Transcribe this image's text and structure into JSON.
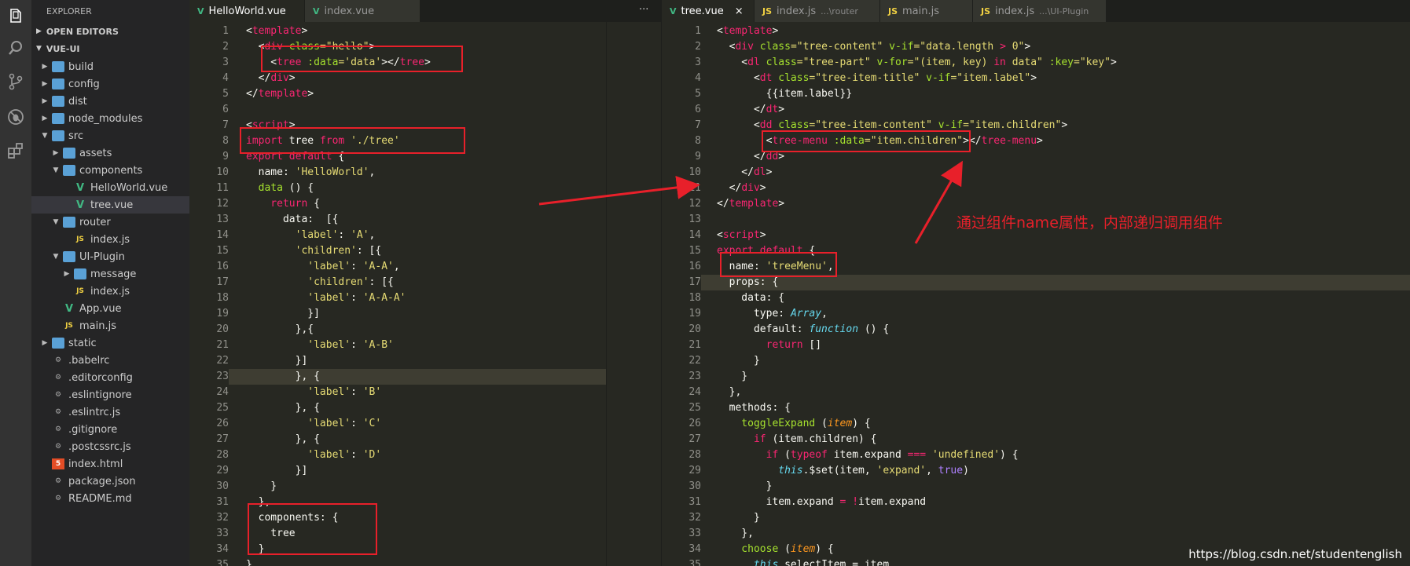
{
  "explorer": {
    "title": "EXPLORER",
    "open_editors": "OPEN EDITORS",
    "project": "VUE-UI",
    "tree": [
      {
        "label": "build",
        "type": "folder",
        "depth": 1,
        "expanded": false
      },
      {
        "label": "config",
        "type": "folder",
        "depth": 1,
        "expanded": false
      },
      {
        "label": "dist",
        "type": "folder",
        "depth": 1,
        "expanded": false
      },
      {
        "label": "node_modules",
        "type": "folder",
        "depth": 1,
        "expanded": false
      },
      {
        "label": "src",
        "type": "folder",
        "depth": 1,
        "expanded": true
      },
      {
        "label": "assets",
        "type": "folder",
        "depth": 2,
        "expanded": false
      },
      {
        "label": "components",
        "type": "folder",
        "depth": 2,
        "expanded": true
      },
      {
        "label": "HelloWorld.vue",
        "type": "vue",
        "depth": 3
      },
      {
        "label": "tree.vue",
        "type": "vue",
        "depth": 3,
        "selected": true
      },
      {
        "label": "router",
        "type": "folder",
        "depth": 2,
        "expanded": true
      },
      {
        "label": "index.js",
        "type": "js",
        "depth": 3
      },
      {
        "label": "UI-Plugin",
        "type": "folder",
        "depth": 2,
        "expanded": true
      },
      {
        "label": "message",
        "type": "folder",
        "depth": 3,
        "expanded": false
      },
      {
        "label": "index.js",
        "type": "js",
        "depth": 3
      },
      {
        "label": "App.vue",
        "type": "vue",
        "depth": 2
      },
      {
        "label": "main.js",
        "type": "js",
        "depth": 2
      },
      {
        "label": "static",
        "type": "folder",
        "depth": 1,
        "expanded": false
      },
      {
        "label": ".babelrc",
        "type": "cfg",
        "depth": 1
      },
      {
        "label": ".editorconfig",
        "type": "cfg",
        "depth": 1
      },
      {
        "label": ".eslintignore",
        "type": "cfg",
        "depth": 1
      },
      {
        "label": ".eslintrc.js",
        "type": "cfg",
        "depth": 1
      },
      {
        "label": ".gitignore",
        "type": "cfg",
        "depth": 1
      },
      {
        "label": ".postcssrc.js",
        "type": "cfg",
        "depth": 1
      },
      {
        "label": "index.html",
        "type": "html",
        "depth": 1
      },
      {
        "label": "package.json",
        "type": "cfg",
        "depth": 1
      },
      {
        "label": "README.md",
        "type": "cfg",
        "depth": 1
      }
    ]
  },
  "left_tabs": [
    {
      "label": "HelloWorld.vue",
      "icon": "vue",
      "active": true
    },
    {
      "label": "index.vue",
      "icon": "vue",
      "active": false
    }
  ],
  "left_tab_more": "···",
  "right_tabs": [
    {
      "label": "tree.vue",
      "icon": "vue",
      "active": true,
      "close": "×"
    },
    {
      "label": "index.js",
      "icon": "JS",
      "desc": "...\\router"
    },
    {
      "label": "main.js",
      "icon": "JS"
    },
    {
      "label": "index.js",
      "icon": "JS",
      "desc": "...\\UI-Plugin"
    }
  ],
  "left_code": [
    [
      [
        "<",
        "p"
      ],
      [
        "template",
        "k"
      ],
      [
        ">",
        "p"
      ]
    ],
    [
      [
        "  <",
        "p"
      ],
      [
        "div ",
        "k"
      ],
      [
        "class",
        "a"
      ],
      [
        "=\"hello\"",
        "s"
      ],
      [
        ">",
        "p"
      ]
    ],
    [
      [
        "    <",
        "p"
      ],
      [
        "tree ",
        "k"
      ],
      [
        ":data",
        "a"
      ],
      [
        "='data'",
        "s"
      ],
      [
        "></",
        "p"
      ],
      [
        "tree",
        "k"
      ],
      [
        ">",
        "p"
      ]
    ],
    [
      [
        "  </",
        "p"
      ],
      [
        "div",
        "k"
      ],
      [
        ">",
        "p"
      ]
    ],
    [
      [
        "</",
        "p"
      ],
      [
        "template",
        "k"
      ],
      [
        ">",
        "p"
      ]
    ],
    [],
    [
      [
        "<",
        "p"
      ],
      [
        "script",
        "k"
      ],
      [
        ">",
        "p"
      ]
    ],
    [
      [
        "import ",
        "k"
      ],
      [
        "tree ",
        "p"
      ],
      [
        "from ",
        "k"
      ],
      [
        "'./tree'",
        "s"
      ]
    ],
    [
      [
        "export default ",
        "k"
      ],
      [
        "{",
        "p"
      ]
    ],
    [
      [
        "  name",
        "p"
      ],
      [
        ": ",
        "p"
      ],
      [
        "'HelloWorld'",
        "s"
      ],
      [
        ",",
        "p"
      ]
    ],
    [
      [
        "  data ",
        "a"
      ],
      [
        "() {",
        "p"
      ]
    ],
    [
      [
        "    return ",
        "k"
      ],
      [
        "{",
        "p"
      ]
    ],
    [
      [
        "      data:  [{",
        "p"
      ]
    ],
    [
      [
        "        'label'",
        "s"
      ],
      [
        ": ",
        "p"
      ],
      [
        "'A'",
        "s"
      ],
      [
        ",",
        "p"
      ]
    ],
    [
      [
        "        'children'",
        "s"
      ],
      [
        ": [{",
        "p"
      ]
    ],
    [
      [
        "          'label'",
        "s"
      ],
      [
        ": ",
        "p"
      ],
      [
        "'A-A'",
        "s"
      ],
      [
        ",",
        "p"
      ]
    ],
    [
      [
        "          'children'",
        "s"
      ],
      [
        ": [{",
        "p"
      ]
    ],
    [
      [
        "          'label'",
        "s"
      ],
      [
        ": ",
        "p"
      ],
      [
        "'A-A-A'",
        "s"
      ]
    ],
    [
      [
        "          }]",
        "p"
      ]
    ],
    [
      [
        "        },{",
        "p"
      ]
    ],
    [
      [
        "          'label'",
        "s"
      ],
      [
        ": ",
        "p"
      ],
      [
        "'A-B'",
        "s"
      ]
    ],
    [
      [
        "        }]",
        "p"
      ]
    ],
    [
      [
        "        }, {",
        "p"
      ]
    ],
    [
      [
        "          'label'",
        "s"
      ],
      [
        ": ",
        "p"
      ],
      [
        "'B'",
        "s"
      ]
    ],
    [
      [
        "        }, {",
        "p"
      ]
    ],
    [
      [
        "          'label'",
        "s"
      ],
      [
        ": ",
        "p"
      ],
      [
        "'C'",
        "s"
      ]
    ],
    [
      [
        "        }, {",
        "p"
      ]
    ],
    [
      [
        "          'label'",
        "s"
      ],
      [
        ": ",
        "p"
      ],
      [
        "'D'",
        "s"
      ]
    ],
    [
      [
        "        }]",
        "p"
      ]
    ],
    [
      [
        "    }",
        "p"
      ]
    ],
    [
      [
        "  },",
        "p"
      ]
    ],
    [
      [
        "  components: {",
        "p"
      ]
    ],
    [
      [
        "    tree",
        "p"
      ]
    ],
    [
      [
        "  }",
        "p"
      ]
    ],
    [
      [
        "}",
        "p"
      ]
    ]
  ],
  "right_code": [
    [
      [
        "<",
        "p"
      ],
      [
        "template",
        "k"
      ],
      [
        ">",
        "p"
      ]
    ],
    [
      [
        "  <",
        "p"
      ],
      [
        "div ",
        "k"
      ],
      [
        "class",
        "a"
      ],
      [
        "=\"tree-content\" ",
        "s"
      ],
      [
        "v-if",
        "a"
      ],
      [
        "=\"data.length ",
        "s"
      ],
      [
        ">",
        "k"
      ],
      [
        " 0\"",
        "s"
      ],
      [
        ">",
        "p"
      ]
    ],
    [
      [
        "    <",
        "p"
      ],
      [
        "dl ",
        "k"
      ],
      [
        "class",
        "a"
      ],
      [
        "=\"tree-part\" ",
        "s"
      ],
      [
        "v-for",
        "a"
      ],
      [
        "=\"(item, key) ",
        "s"
      ],
      [
        "in",
        "k"
      ],
      [
        " data\" ",
        "s"
      ],
      [
        ":key",
        "a"
      ],
      [
        "=\"key\"",
        "s"
      ],
      [
        ">",
        "p"
      ]
    ],
    [
      [
        "      <",
        "p"
      ],
      [
        "dt ",
        "k"
      ],
      [
        "class",
        "a"
      ],
      [
        "=\"tree-item-title\" ",
        "s"
      ],
      [
        "v-if",
        "a"
      ],
      [
        "=\"item.label\"",
        "s"
      ],
      [
        ">",
        "p"
      ]
    ],
    [
      [
        "        {{item.label}}",
        "p"
      ]
    ],
    [
      [
        "      </",
        "p"
      ],
      [
        "dt",
        "k"
      ],
      [
        ">",
        "p"
      ]
    ],
    [
      [
        "      <",
        "p"
      ],
      [
        "dd ",
        "k"
      ],
      [
        "class",
        "a"
      ],
      [
        "=\"tree-item-content\" ",
        "s"
      ],
      [
        "v-if",
        "a"
      ],
      [
        "=\"item.children\"",
        "s"
      ],
      [
        ">",
        "p"
      ]
    ],
    [
      [
        "        <",
        "p"
      ],
      [
        "tree-menu ",
        "k"
      ],
      [
        ":data",
        "a"
      ],
      [
        "=\"item.children\"",
        "s"
      ],
      [
        "></",
        "p"
      ],
      [
        "tree-menu",
        "k"
      ],
      [
        ">",
        "p"
      ]
    ],
    [
      [
        "      </",
        "p"
      ],
      [
        "dd",
        "k"
      ],
      [
        ">",
        "p"
      ]
    ],
    [
      [
        "    </",
        "p"
      ],
      [
        "dl",
        "k"
      ],
      [
        ">",
        "p"
      ]
    ],
    [
      [
        "  </",
        "p"
      ],
      [
        "div",
        "k"
      ],
      [
        ">",
        "p"
      ]
    ],
    [
      [
        "</",
        "p"
      ],
      [
        "template",
        "k"
      ],
      [
        ">",
        "p"
      ]
    ],
    [],
    [
      [
        "<",
        "p"
      ],
      [
        "script",
        "k"
      ],
      [
        ">",
        "p"
      ]
    ],
    [
      [
        "export default ",
        "k"
      ],
      [
        "{",
        "p"
      ]
    ],
    [
      [
        "  name",
        "p"
      ],
      [
        ": ",
        "p"
      ],
      [
        "'treeMenu'",
        "s"
      ],
      [
        ",",
        "p"
      ]
    ],
    [
      [
        "  props",
        "p"
      ],
      [
        ": {",
        "p"
      ]
    ],
    [
      [
        "    data",
        "p"
      ],
      [
        ": {",
        "p"
      ]
    ],
    [
      [
        "      type",
        "p"
      ],
      [
        ": ",
        "p"
      ],
      [
        "Array",
        "t"
      ],
      [
        ",",
        "p"
      ]
    ],
    [
      [
        "      default",
        "p"
      ],
      [
        ": ",
        "p"
      ],
      [
        "function ",
        "t"
      ],
      [
        "() {",
        "p"
      ]
    ],
    [
      [
        "        return ",
        "k"
      ],
      [
        "[]",
        "p"
      ]
    ],
    [
      [
        "      }",
        "p"
      ]
    ],
    [
      [
        "    }",
        "p"
      ]
    ],
    [
      [
        "  },",
        "p"
      ]
    ],
    [
      [
        "  methods: {",
        "p"
      ]
    ],
    [
      [
        "    toggleExpand ",
        "a"
      ],
      [
        "(",
        "p"
      ],
      [
        "item",
        "pi"
      ],
      [
        ") {",
        "p"
      ]
    ],
    [
      [
        "      if ",
        "k"
      ],
      [
        "(item.children) {",
        "p"
      ]
    ],
    [
      [
        "        if ",
        "k"
      ],
      [
        "(",
        "p"
      ],
      [
        "typeof ",
        "k"
      ],
      [
        "item.expand ",
        "p"
      ],
      [
        "=== ",
        "k"
      ],
      [
        "'undefined'",
        "s"
      ],
      [
        ") {",
        "p"
      ]
    ],
    [
      [
        "          this",
        "t"
      ],
      [
        ".$set(item, ",
        "p"
      ],
      [
        "'expand'",
        "s"
      ],
      [
        ", ",
        "p"
      ],
      [
        "true",
        "n"
      ],
      [
        ")",
        "p"
      ]
    ],
    [
      [
        "        }",
        "p"
      ]
    ],
    [
      [
        "        item.expand ",
        "p"
      ],
      [
        "= !",
        "k"
      ],
      [
        "item.expand",
        "p"
      ]
    ],
    [
      [
        "      }",
        "p"
      ]
    ],
    [
      [
        "    },",
        "p"
      ]
    ],
    [
      [
        "    choose ",
        "a"
      ],
      [
        "(",
        "p"
      ],
      [
        "item",
        "pi"
      ],
      [
        ") {",
        "p"
      ]
    ],
    [
      [
        "      this",
        "t"
      ],
      [
        ".selectItem = item",
        "p"
      ]
    ]
  ],
  "annotation": "通过组件name属性，内部递归调用组件",
  "watermark": "https://blog.csdn.net/studentenglish",
  "accent": "#e8202a"
}
